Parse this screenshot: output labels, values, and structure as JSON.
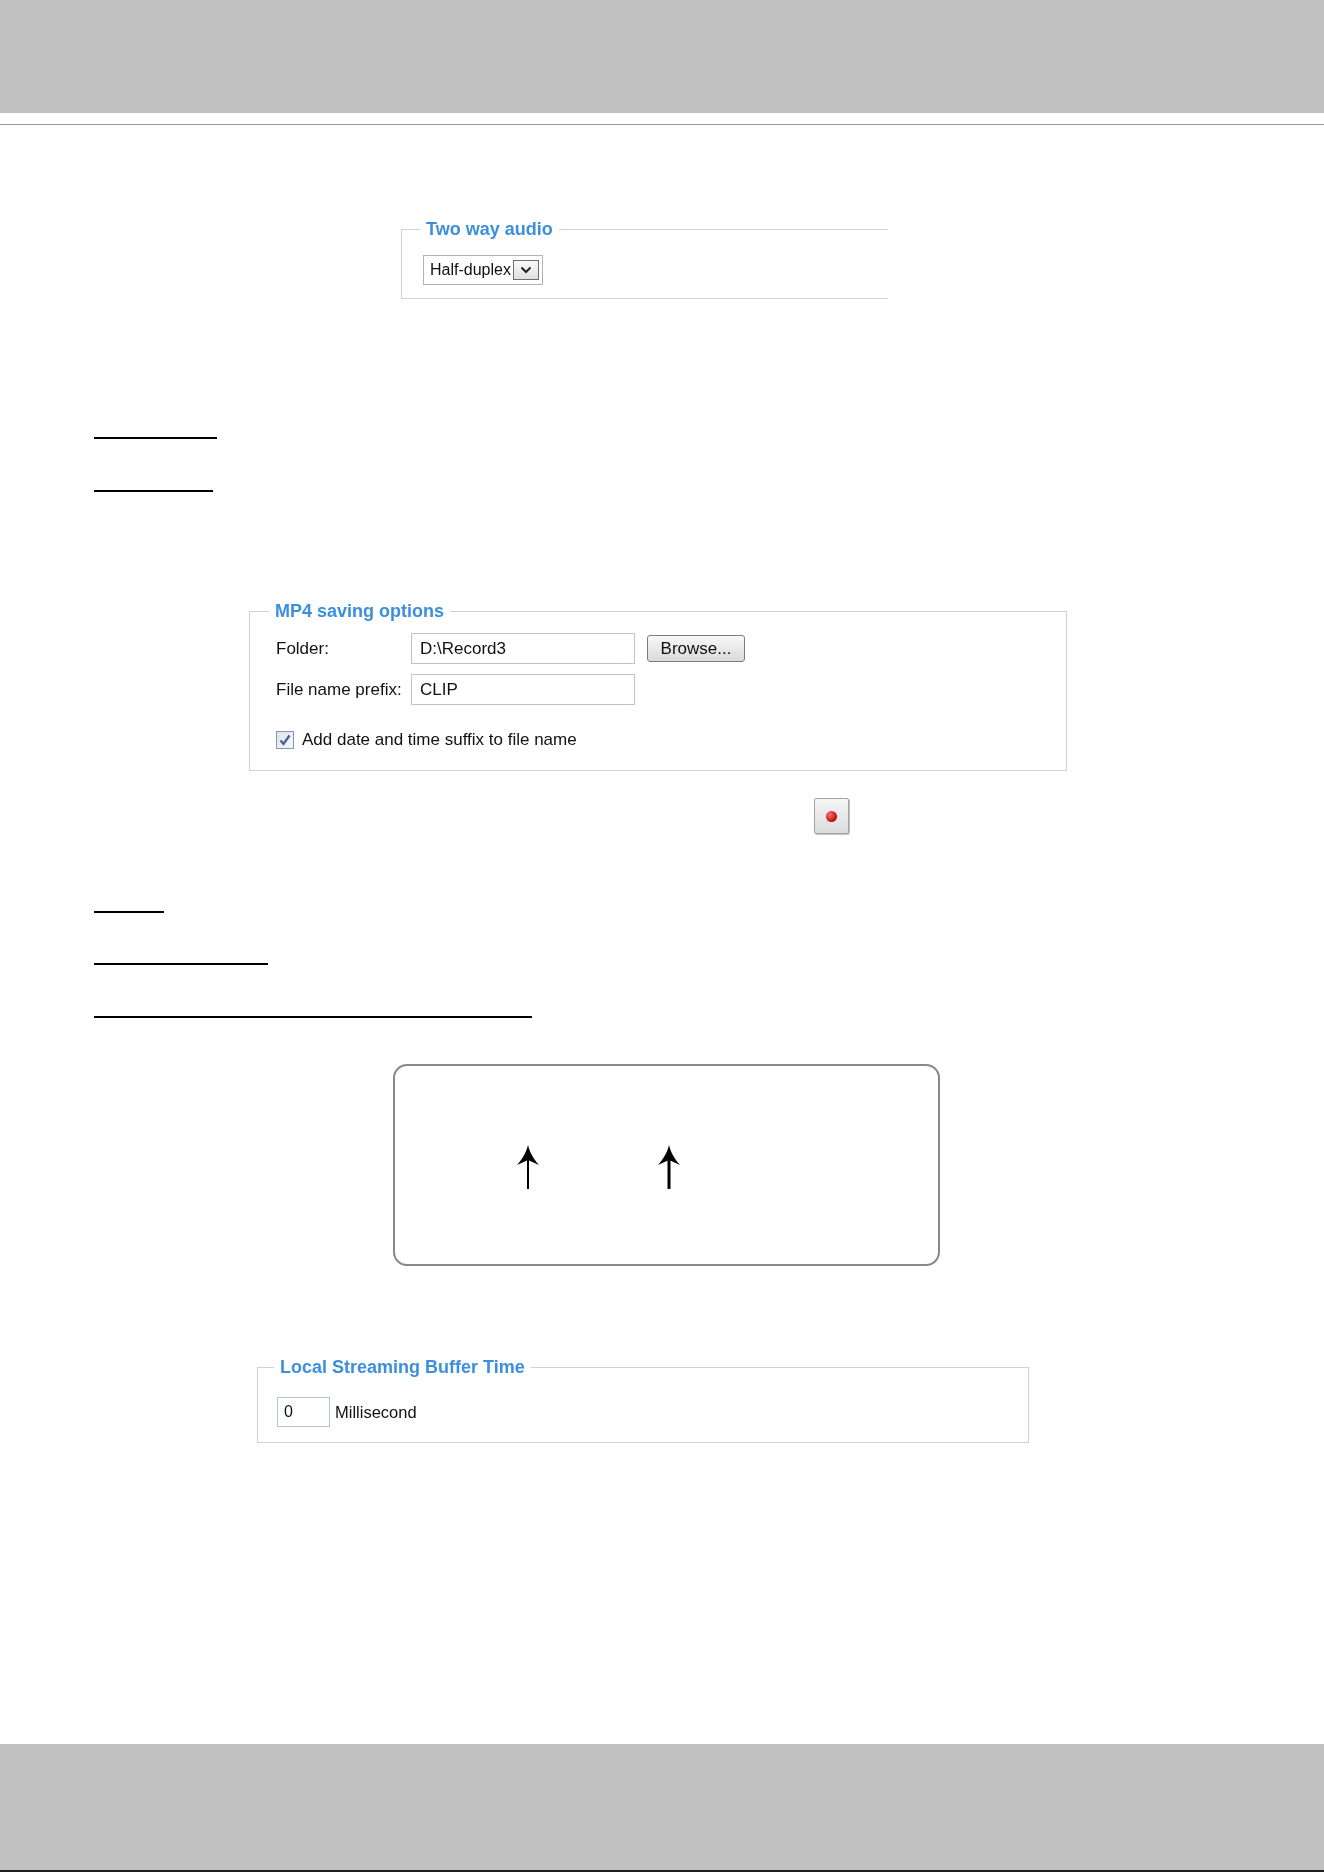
{
  "two_way_audio": {
    "title": "Two way audio",
    "mode": "Half-duplex"
  },
  "mp4_saving_options": {
    "title": "MP4 saving options",
    "folder": {
      "label": "Folder:",
      "value": "D:\\Record3"
    },
    "browse_button": "Browse...",
    "file_name_prefix": {
      "label": "File name prefix:",
      "value": "CLIP"
    },
    "date_time_suffix": {
      "label": "Add date and time suffix to file name",
      "checked": true
    }
  },
  "local_streaming_buffer_time": {
    "title": "Local Streaming Buffer Time",
    "value": "0",
    "unit": "Millisecond"
  }
}
